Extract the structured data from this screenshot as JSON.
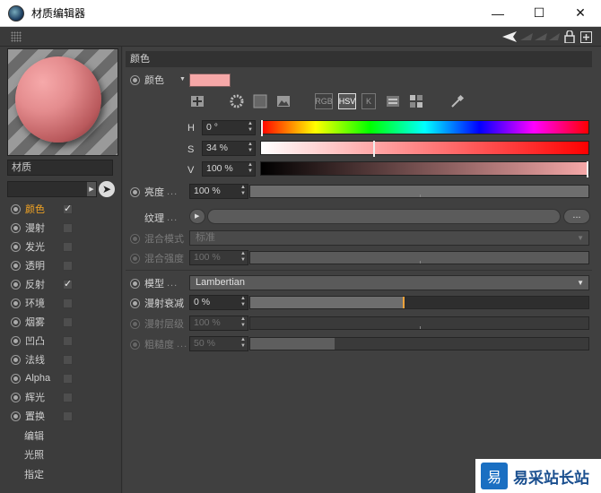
{
  "window": {
    "title": "材质编辑器",
    "minimize": "—",
    "maximize": "☐",
    "close": "✕"
  },
  "left": {
    "material_name": "材质",
    "channels": [
      {
        "label": "颜色",
        "checked": true,
        "active": true
      },
      {
        "label": "漫射",
        "checked": false,
        "active": false
      },
      {
        "label": "发光",
        "checked": false,
        "active": false
      },
      {
        "label": "透明",
        "checked": false,
        "active": false
      },
      {
        "label": "反射",
        "checked": true,
        "active": false
      },
      {
        "label": "环境",
        "checked": false,
        "active": false
      },
      {
        "label": "烟雾",
        "checked": false,
        "active": false
      },
      {
        "label": "凹凸",
        "checked": false,
        "active": false
      },
      {
        "label": "法线",
        "checked": false,
        "active": false
      },
      {
        "label": "Alpha",
        "checked": false,
        "active": false
      },
      {
        "label": "辉光",
        "checked": false,
        "active": false
      },
      {
        "label": "置换",
        "checked": false,
        "active": false
      }
    ],
    "extras": [
      "编辑",
      "光照",
      "指定"
    ],
    "check_mark": "✓"
  },
  "right": {
    "section_title": "颜色",
    "color_label": "颜色",
    "swatch_color": "#f6a8a8",
    "mode_icons": [
      "RGB",
      "HSV",
      "K"
    ],
    "h_label": "H",
    "h_value": "0 °",
    "s_label": "S",
    "s_value": "34 %",
    "s_fraction": 0.34,
    "v_label": "V",
    "v_value": "100 %",
    "v_fraction": 1.0,
    "brightness_label": "亮度",
    "brightness_value": "100 %",
    "brightness_fraction": 1.0,
    "texture_label": "纹理",
    "texture_button": "...",
    "blend_mode_label": "混合模式",
    "blend_mode_value": "标准",
    "blend_strength_label": "混合强度",
    "blend_strength_value": "100 %",
    "model_label": "模型",
    "model_value": "Lambertian",
    "diffuse_falloff_label": "漫射衰减",
    "diffuse_falloff_value": "0 %",
    "diffuse_falloff_fraction": 0.45,
    "diffuse_level_label": "漫射层级",
    "diffuse_level_value": "100 %",
    "roughness_label": "粗糙度",
    "roughness_value": "50 %",
    "roughness_fraction": 0.25,
    "dots": "..."
  },
  "watermark": {
    "logo": "易",
    "text": "易采站长站"
  }
}
